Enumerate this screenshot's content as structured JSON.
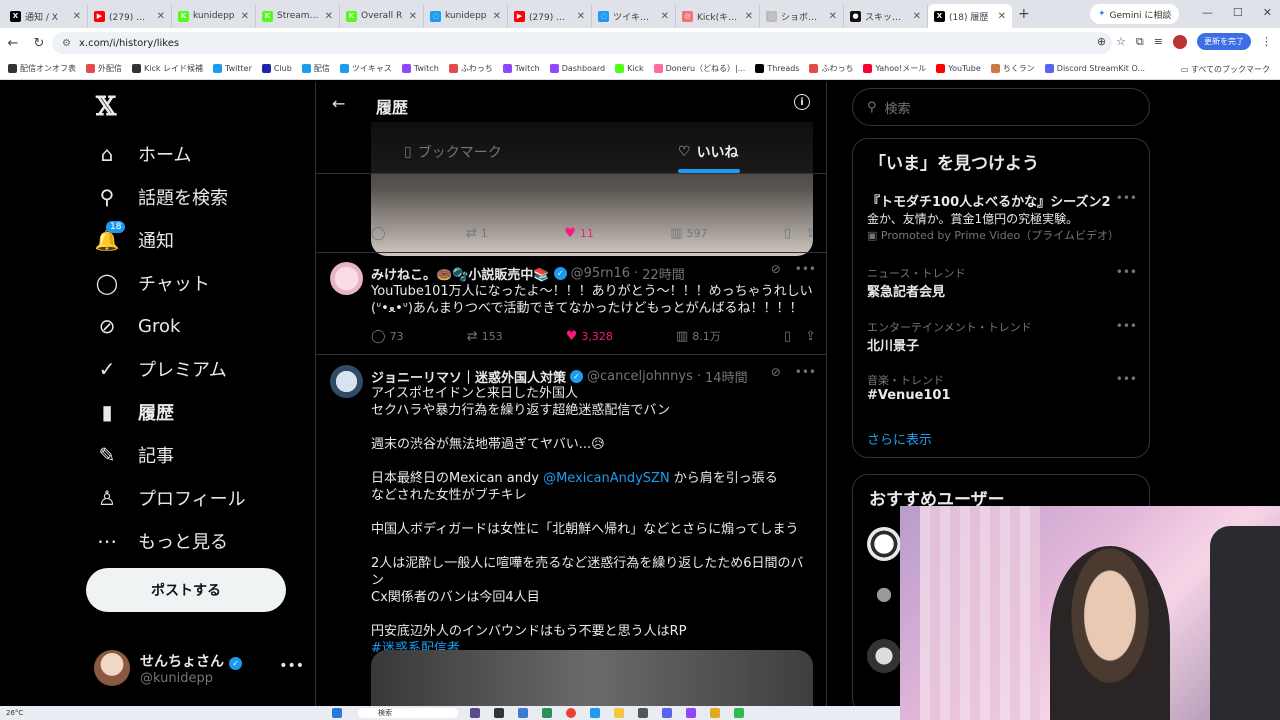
{
  "browser": {
    "tabs": [
      {
        "label": "通知 / X",
        "color": "#000000",
        "glyph": "X"
      },
      {
        "label": "(279) 雑...",
        "color": "#ff0000",
        "glyph": "▶"
      },
      {
        "label": "kunidepp",
        "color": "#53fc18",
        "glyph": "K"
      },
      {
        "label": "Stream - K",
        "color": "#53fc18",
        "glyph": "K"
      },
      {
        "label": "Overall R",
        "color": "#53fc18",
        "glyph": "K"
      },
      {
        "label": "kunidepp",
        "color": "#1d9bf0",
        "glyph": "◌"
      },
      {
        "label": "(279) 雑...",
        "color": "#ff0000",
        "glyph": "▶"
      },
      {
        "label": "ツイキャス",
        "color": "#1d9bf0",
        "glyph": "◌"
      },
      {
        "label": "Kick(キック",
        "color": "#f87171",
        "glyph": "◎"
      },
      {
        "label": "ショボンKIC",
        "color": "#bbbbbb",
        "glyph": "◌"
      },
      {
        "label": "スキッパーブ",
        "color": "#111111",
        "glyph": "●"
      },
      {
        "label": "(18) 履歴",
        "color": "#000000",
        "glyph": "X",
        "active": true
      }
    ],
    "gemini_label": "Gemini に相談",
    "url": "x.com/i/history/likes",
    "update_label": "更新を完了",
    "bookmarks": [
      {
        "label": "配信オンオフ表",
        "color": "#333333"
      },
      {
        "label": "外配信",
        "color": "#e34b4b"
      },
      {
        "label": "Kick レイド候補",
        "color": "#333333"
      },
      {
        "label": "Twitter",
        "color": "#1d9bf0"
      },
      {
        "label": "Club",
        "color": "#2222aa"
      },
      {
        "label": "配信",
        "color": "#1d9bf0"
      },
      {
        "label": "ツイキャス",
        "color": "#1d9bf0"
      },
      {
        "label": "Twitch",
        "color": "#9146ff"
      },
      {
        "label": "ふわっち",
        "color": "#e34b4b"
      },
      {
        "label": "Twitch",
        "color": "#9146ff"
      },
      {
        "label": "Dashboard",
        "color": "#9146ff"
      },
      {
        "label": "Kick",
        "color": "#53fc18"
      },
      {
        "label": "Doneru（どねる）|...",
        "color": "#ff6b9a"
      },
      {
        "label": "Threads",
        "color": "#000000"
      },
      {
        "label": "ふわっち",
        "color": "#e34b4b"
      },
      {
        "label": "Yahoo!メール",
        "color": "#ff0033"
      },
      {
        "label": "YouTube",
        "color": "#ff0000"
      },
      {
        "label": "ちくラン",
        "color": "#cc7744"
      },
      {
        "label": "Discord StreamKit O...",
        "color": "#5865f2"
      }
    ],
    "all_bookmarks": "すべてのブックマーク"
  },
  "nav": {
    "items": [
      {
        "label": "ホーム",
        "icon": "home-icon",
        "glyph": "⌂"
      },
      {
        "label": "話題を検索",
        "icon": "search-icon",
        "glyph": "⚲"
      },
      {
        "label": "通知",
        "icon": "bell-icon",
        "glyph": "🔔",
        "badge": "18"
      },
      {
        "label": "チャット",
        "icon": "chat-icon",
        "glyph": "◯"
      },
      {
        "label": "Grok",
        "icon": "grok-icon",
        "glyph": "⊘"
      },
      {
        "label": "プレミアム",
        "icon": "premium-icon",
        "glyph": "✓"
      },
      {
        "label": "履歴",
        "icon": "bookmark-icon",
        "glyph": "▮",
        "active": true
      },
      {
        "label": "記事",
        "icon": "article-icon",
        "glyph": "✎"
      },
      {
        "label": "プロフィール",
        "icon": "profile-icon",
        "glyph": "♙"
      },
      {
        "label": "もっと見る",
        "icon": "more-icon",
        "glyph": "⋯"
      }
    ],
    "post_label": "ポストする",
    "account": {
      "name": "せんちょさん",
      "handle": "@kunidepp"
    }
  },
  "main": {
    "title": "履歴",
    "tabs": {
      "bookmarks": "ブックマーク",
      "likes": "いいね"
    },
    "first_tweet_stats": {
      "replies": "",
      "retweets": "1",
      "likes": "11",
      "views": "597"
    },
    "tweet1": {
      "name": "みけねこ。🍩🫧小説販売中📚",
      "handle": "@95rn16",
      "time": "22時間",
      "lines": [
        "YouTube101万人になったよ〜！！！ありがとう〜！！！めっちゃうれしい",
        "(ᐡ•ﻌ•ᐡ)あんまりつべで活動できてなかったけどもっとがんばるね！！！！"
      ],
      "stats": {
        "replies": "73",
        "retweets": "153",
        "likes": "3,328",
        "views": "8.1万"
      }
    },
    "tweet2": {
      "name": "ジョニーリマソ｜迷惑外国人対策",
      "handle": "@canceljohnnys",
      "time": "14時間",
      "line1": "アイスポセイドンと来日した外国人",
      "line2": "セクハラや暴力行為を繰り返す超絶迷惑配信でバン",
      "line3": "週末の渋谷が無法地帯過ぎてヤバい...😥",
      "line4a": "日本最終日のMexican andy ",
      "line4link": "@MexicanAndySZN",
      "line4b": " から肩を引っ張る",
      "line5": "などされた女性がブチキレ",
      "line6": "中国人ボディガードは女性に「北朝鮮へ帰れ」などとさらに煽ってしまう",
      "line7": "2人は泥酔し一般人に喧嘩を売るなど迷惑行為を繰り返したため6日間のバン",
      "line8": "Cx関係者のバンは今回4人目",
      "line9": "円安底辺外人のインバウンドはもう不要と思う人はRP",
      "hashtag": "#迷惑系配信者"
    }
  },
  "sidebar": {
    "search_placeholder": "検索",
    "trends_title": "「いま」を見つけよう",
    "trends": [
      {
        "category": "",
        "title": "『トモダチ100人よべるかな』シーズン2",
        "sub": "金か、友情か。賞金1億円の究極実験。",
        "promo": "Promoted by Prime Video（プライムビデオ）"
      },
      {
        "category": "ニュース・トレンド",
        "title": "緊急記者会見"
      },
      {
        "category": "エンターテインメント・トレンド",
        "title": "北川景子"
      },
      {
        "category": "音楽・トレンド",
        "title": "#Venue101"
      }
    ],
    "show_more": "さらに表示",
    "who_to_follow": "おすすめユーザー"
  },
  "taskbar": {
    "temperature": "26°C",
    "search": "検索"
  }
}
